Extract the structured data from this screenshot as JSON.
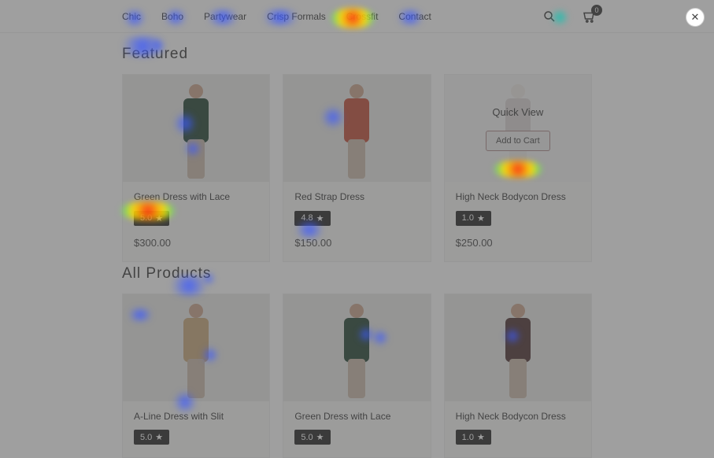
{
  "nav": {
    "items": [
      "Chic",
      "Boho",
      "Partywear",
      "Crisp Formals",
      "Crossfit",
      "Contact"
    ],
    "cart_count": "0"
  },
  "sections": {
    "featured_title": "Featured",
    "all_title": "All Products"
  },
  "featured": [
    {
      "name": "Green Dress with Lace",
      "rating": "5.0",
      "price": "$300.00",
      "torso": "#1f4030"
    },
    {
      "name": "Red Strap Dress",
      "rating": "4.8",
      "price": "$150.00",
      "torso": "#c24a33"
    },
    {
      "name": "High Neck Bodycon Dress",
      "rating": "1.0",
      "price": "$250.00",
      "torso": "#4a2d2d",
      "hover": true
    }
  ],
  "hover": {
    "quick_view": "Quick View",
    "add_to_cart": "Add to Cart"
  },
  "all": [
    {
      "name": "A-Line Dress with Slit",
      "rating": "5.0",
      "torso": "#c8a678"
    },
    {
      "name": "Green Dress with Lace",
      "rating": "5.0",
      "torso": "#1f4030"
    },
    {
      "name": "High Neck Bodycon Dress",
      "rating": "1.0",
      "torso": "#4a2d2d"
    }
  ],
  "icons": {
    "star": "★",
    "close": "✕"
  }
}
